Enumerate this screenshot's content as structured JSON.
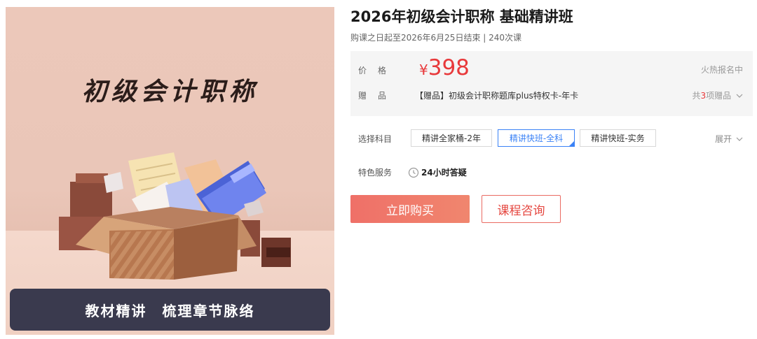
{
  "promo": {
    "title": "初级会计职称",
    "banner": "教材精讲　梳理章节脉络"
  },
  "course": {
    "title": "2026年初级会计职称 基础精讲班",
    "subtitle": "购课之日起至2026年6月25日结束 | 240次课"
  },
  "pricing": {
    "price_label": "价格",
    "currency": "¥",
    "price": "398",
    "hot_text": "火热报名中",
    "gift_label": "赠品",
    "gift_text": "【赠品】初级会计职称题库plus特权卡-年卡",
    "gift_count_prefix": "共",
    "gift_count": "3",
    "gift_count_suffix": "项赠品",
    "price_color": "#e8393b"
  },
  "subjects": {
    "label": "选择科目",
    "options": [
      "精讲全家桶-2年",
      "精讲快班-全科",
      "精讲快班-实务"
    ],
    "selected_index": 1,
    "expand_label": "展开"
  },
  "services": {
    "label": "特色服务",
    "items": [
      {
        "icon": "chat-clock-icon",
        "text": "24小时答疑"
      }
    ]
  },
  "actions": {
    "buy_label": "立即购买",
    "consult_label": "课程咨询",
    "accent": "#ef7068"
  }
}
